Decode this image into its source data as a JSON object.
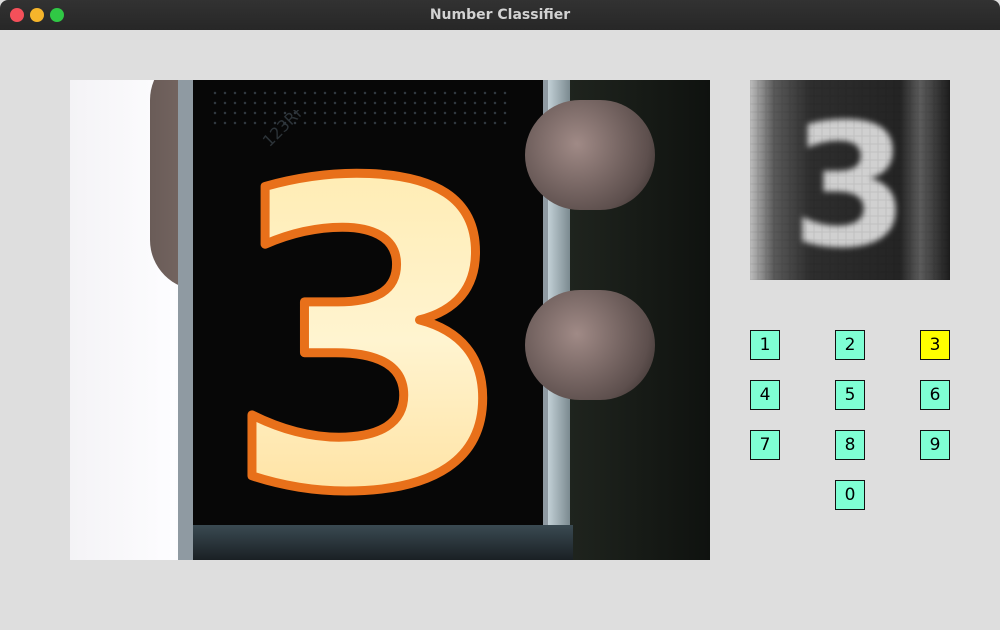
{
  "window": {
    "title": "Number Classifier"
  },
  "camera": {
    "detected_digit": "3",
    "watermark": "123RF"
  },
  "preview": {
    "digit": "3"
  },
  "digits": {
    "buttons": [
      "1",
      "2",
      "3",
      "4",
      "5",
      "6",
      "7",
      "8",
      "9",
      "0"
    ],
    "selected": "3",
    "inactive_color": "#7fffd4",
    "active_color": "#ffff00"
  }
}
